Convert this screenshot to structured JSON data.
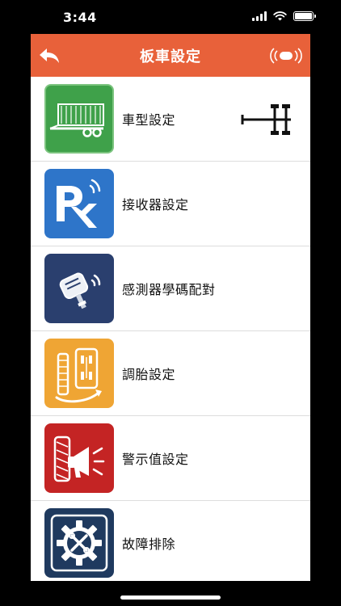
{
  "status_bar": {
    "time": "3:44"
  },
  "nav": {
    "title": "板車設定"
  },
  "menu": [
    {
      "label": "車型設定",
      "icon": "trailer-icon",
      "color": "#3fa14a"
    },
    {
      "label": "接收器設定",
      "icon": "receiver-rx-icon",
      "color": "#2e75c9"
    },
    {
      "label": "感測器學碼配對",
      "icon": "sensor-pairing-icon",
      "color": "#2a3f6e"
    },
    {
      "label": "調胎設定",
      "icon": "tire-rotation-icon",
      "color": "#efa534"
    },
    {
      "label": "警示值設定",
      "icon": "alarm-megaphone-icon",
      "color": "#c42424"
    },
    {
      "label": "故障排除",
      "icon": "troubleshooting-gear-icon",
      "color": "#1f3a5f"
    }
  ],
  "colors": {
    "header": "#e8613a",
    "separator": "#dddddd"
  }
}
